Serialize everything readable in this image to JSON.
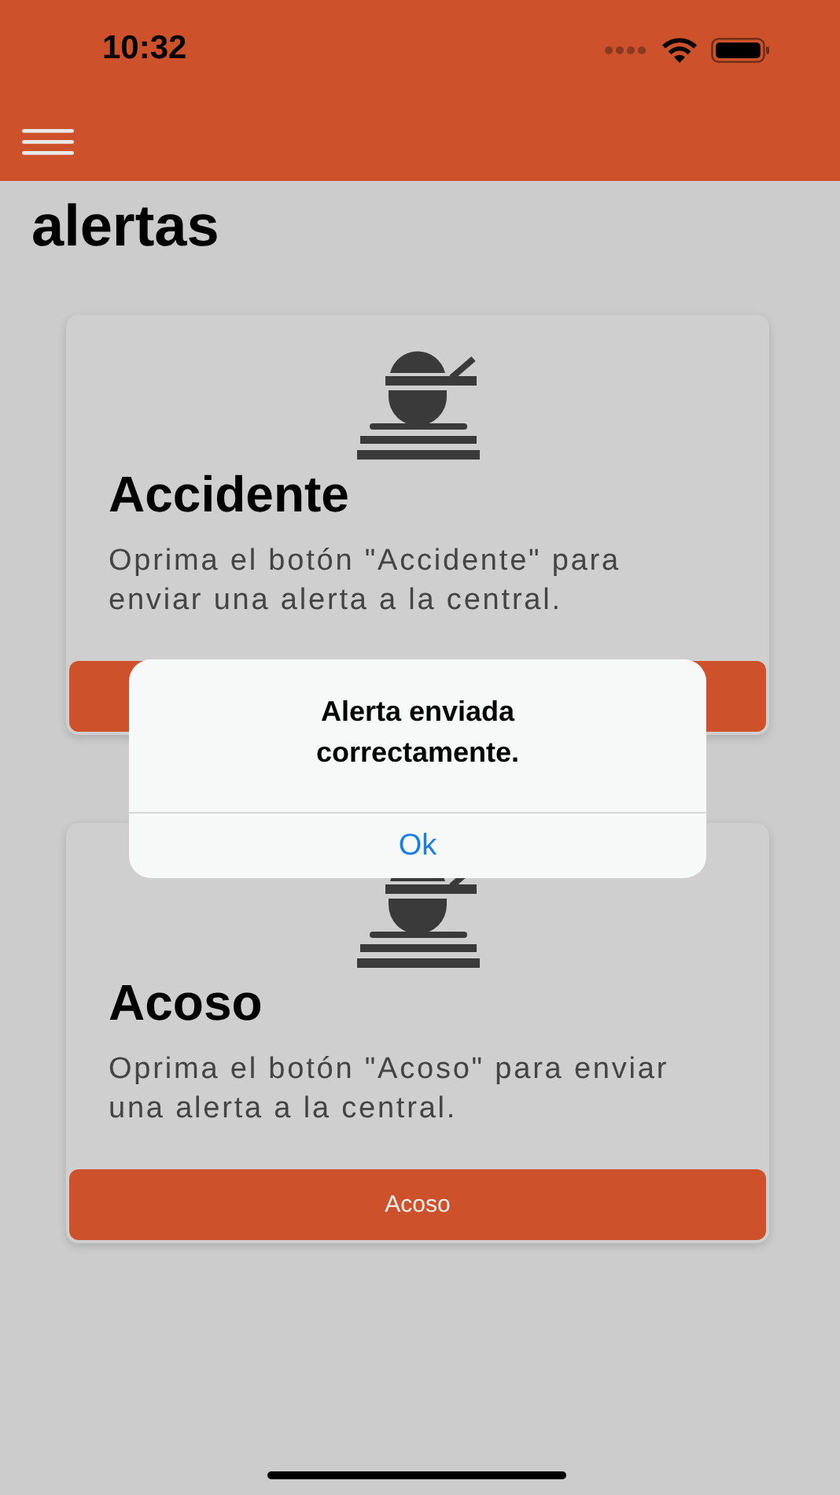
{
  "status_bar": {
    "time": "10:32"
  },
  "page": {
    "title": "alertas"
  },
  "cards": [
    {
      "title": "Accidente",
      "description": "Oprima el botón \"Accidente\" para enviar una alerta a la central."
    },
    {
      "title": "Acoso",
      "description": "Oprima el botón \"Acoso\" para enviar una alerta a la central.",
      "button_label": "Acoso"
    }
  ],
  "dialog": {
    "message": "Alerta enviada correctamente.",
    "button": "Ok"
  }
}
